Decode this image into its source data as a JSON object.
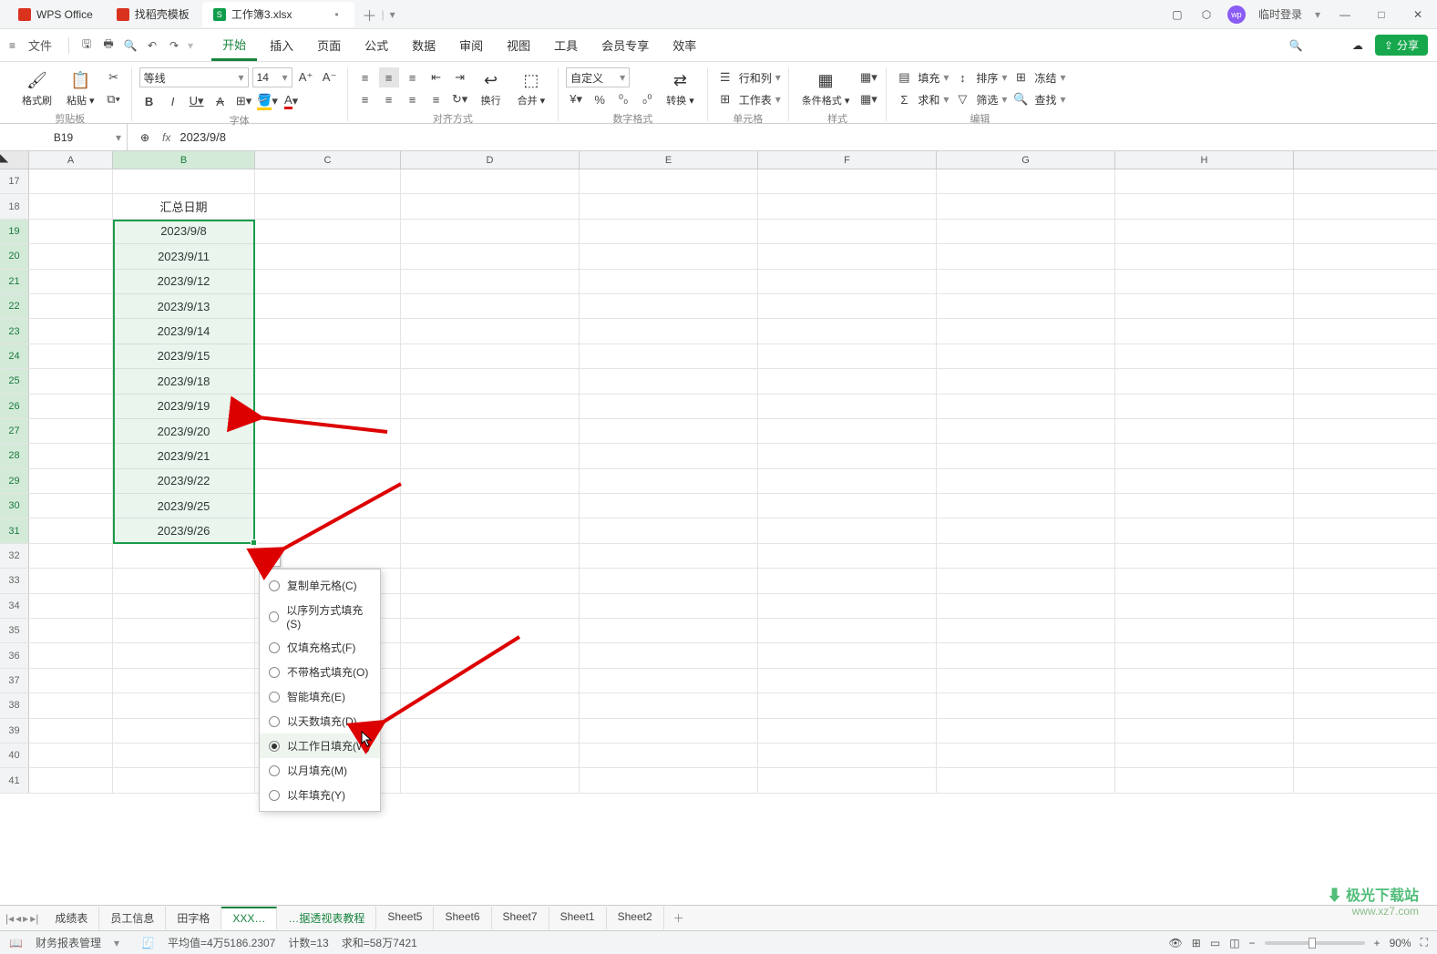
{
  "titlebar": {
    "app_name": "WPS Office",
    "template_tab": "找稻壳模板",
    "doc_tab": "工作簿3.xlsx",
    "login": "临时登录"
  },
  "menubar": {
    "file": "文件",
    "tabs": [
      "开始",
      "插入",
      "页面",
      "公式",
      "数据",
      "审阅",
      "视图",
      "工具",
      "会员专享",
      "效率"
    ],
    "active": 0
  },
  "ribbon": {
    "clipboard": {
      "format_painter": "格式刷",
      "paste": "粘贴",
      "label": "剪贴板"
    },
    "font": {
      "name": "等线",
      "size": "14",
      "label": "字体"
    },
    "align": {
      "wrap": "换行",
      "merge": "合并",
      "label": "对齐方式"
    },
    "number": {
      "format": "自定义",
      "convert": "转换",
      "label": "数字格式"
    },
    "cells": {
      "row_col": "行和列",
      "worksheet": "工作表",
      "label": "单元格"
    },
    "style": {
      "cond": "条件格式",
      "label": "样式"
    },
    "edit": {
      "fill": "填充",
      "sort": "排序",
      "freeze": "冻结",
      "sum": "求和",
      "filter": "筛选",
      "find": "查找",
      "label": "编辑"
    }
  },
  "namebox": {
    "ref": "B19"
  },
  "formula": {
    "value": "2023/9/8"
  },
  "columns": [
    "A",
    "B",
    "C",
    "D",
    "E",
    "F",
    "G",
    "H"
  ],
  "rows_start": 17,
  "rows_end": 41,
  "header_cell": "汇总日期",
  "dates": [
    "2023/9/8",
    "2023/9/11",
    "2023/9/12",
    "2023/9/13",
    "2023/9/14",
    "2023/9/15",
    "2023/9/18",
    "2023/9/19",
    "2023/9/20",
    "2023/9/21",
    "2023/9/22",
    "2023/9/25",
    "2023/9/26"
  ],
  "autofill_menu": {
    "items": [
      {
        "label": "复制单元格(C)",
        "sel": false
      },
      {
        "label": "以序列方式填充(S)",
        "sel": false
      },
      {
        "label": "仅填充格式(F)",
        "sel": false
      },
      {
        "label": "不带格式填充(O)",
        "sel": false
      },
      {
        "label": "智能填充(E)",
        "sel": false
      },
      {
        "label": "以天数填充(D)",
        "sel": false
      },
      {
        "label": "以工作日填充(W)",
        "sel": true
      },
      {
        "label": "以月填充(M)",
        "sel": false
      },
      {
        "label": "以年填充(Y)",
        "sel": false
      }
    ]
  },
  "sheets": {
    "list": [
      "成绩表",
      "员工信息",
      "田字格",
      "XXX…",
      "…据透视表教程",
      "Sheet5",
      "Sheet6",
      "Sheet7",
      "Sheet1",
      "Sheet2"
    ],
    "active": 3
  },
  "status": {
    "doc_mgmt": "财务报表管理",
    "avg": "平均值=4万5186.2307",
    "count": "计数=13",
    "sum": "求和=58万7421",
    "zoom": "90%"
  },
  "watermark": {
    "l1": "极光下载站",
    "l2": "www.xz7.com"
  }
}
